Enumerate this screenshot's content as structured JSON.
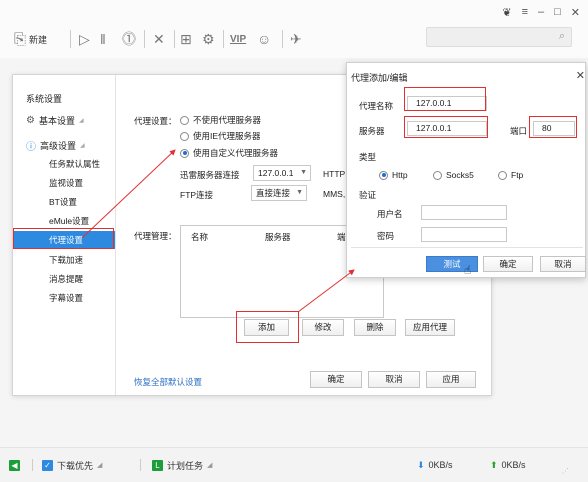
{
  "toolbar": {
    "new_label": "新建"
  },
  "settings": {
    "sidebar": {
      "title": "系统设置",
      "groups": [
        {
          "label": "基本设置",
          "arrow": "◢"
        },
        {
          "label": "高级设置",
          "arrow": "◢"
        }
      ],
      "items": [
        "任务默认属性",
        "监视设置",
        "BT设置",
        "eMule设置",
        "代理设置",
        "下载加速",
        "消息提醒",
        "字幕设置"
      ]
    },
    "proxy_setting_label": "代理设置：",
    "options": [
      {
        "label": "不使用代理服务器",
        "selected": false
      },
      {
        "label": "使用IE代理服务器",
        "selected": false
      },
      {
        "label": "使用自定义代理服务器",
        "selected": true
      }
    ],
    "thunder_label": "迅雷服务器连接",
    "thunder_value": "127.0.0.1",
    "http_label": "HTTP",
    "ftp_label": "FTP连接",
    "ftp_value": "直接连接",
    "mms_label": "MMS,",
    "proxy_mgmt_label": "代理管理：",
    "table_headers": [
      "名称",
      "服务器",
      "端"
    ],
    "buttons": {
      "add": "添加",
      "modify": "修改",
      "delete": "删除",
      "apply_proxy": "应用代理"
    },
    "restore_link": "恢复全部默认设置",
    "footer_buttons": {
      "ok": "确定",
      "cancel": "取消",
      "apply": "应用"
    }
  },
  "proxy_dialog": {
    "title": "代理添加/编辑",
    "name_label": "代理名称",
    "name_value": "127.0.0.1",
    "server_label": "服务器",
    "server_value": "127.0.0.1",
    "port_label": "端口",
    "port_value": "80",
    "type_label": "类型",
    "types": [
      {
        "label": "Http",
        "selected": true
      },
      {
        "label": "Socks5",
        "selected": false
      },
      {
        "label": "Ftp",
        "selected": false
      }
    ],
    "auth_label": "验证",
    "username_label": "用户名",
    "username_value": "",
    "password_label": "密码",
    "password_value": "",
    "buttons": {
      "test": "测试",
      "ok": "确定",
      "cancel": "取消"
    }
  },
  "statusbar": {
    "download_priority": "下载优先",
    "scheduled_tasks": "计划任务",
    "down_speed": "0KB/s",
    "up_speed": "0KB/s"
  },
  "colors": {
    "accent": "#2d8ae0",
    "annotation_red": "#e03030",
    "link": "#2b6fc4",
    "up_green": "#2aa52a"
  }
}
